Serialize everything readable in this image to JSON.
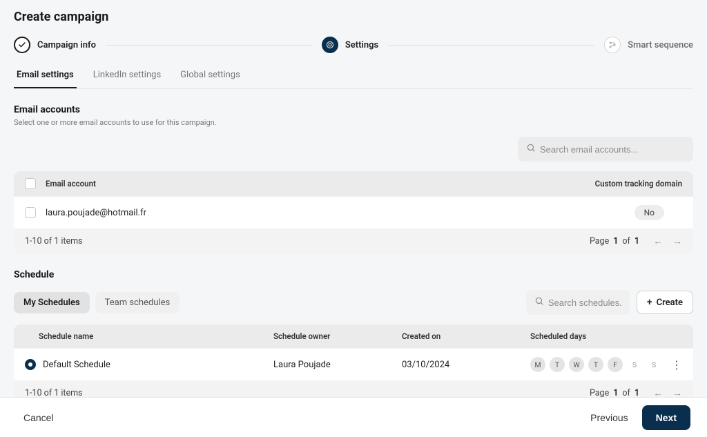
{
  "page_title": "Create campaign",
  "stepper": {
    "step1": "Campaign info",
    "step2": "Settings",
    "step3": "Smart sequence"
  },
  "tabs": {
    "email": "Email settings",
    "linkedin": "LinkedIn settings",
    "global": "Global settings"
  },
  "email_accounts": {
    "title": "Email accounts",
    "subtitle": "Select one or more email accounts to use for this campaign.",
    "search_placeholder": "Search email accounts...",
    "header_account": "Email account",
    "header_domain": "Custom tracking domain",
    "rows": [
      {
        "email": "laura.poujade@hotmail.fr",
        "domain_badge": "No"
      }
    ],
    "footer_count": "1-10 of 1 items",
    "page_label": "Page",
    "page_current": "1",
    "page_of": "of",
    "page_total": "1"
  },
  "schedule": {
    "title": "Schedule",
    "seg_my": "My Schedules",
    "seg_team": "Team schedules",
    "search_placeholder": "Search schedules...",
    "create_label": "Create",
    "header_name": "Schedule name",
    "header_owner": "Schedule owner",
    "header_created": "Created on",
    "header_days": "Scheduled days",
    "rows": [
      {
        "name": "Default Schedule",
        "owner": "Laura Poujade",
        "created": "03/10/2024",
        "days": [
          "M",
          "T",
          "W",
          "T",
          "F",
          "S",
          "S"
        ]
      }
    ],
    "footer_count": "1-10 of 1 items",
    "page_label": "Page",
    "page_current": "1",
    "page_of": "of",
    "page_total": "1"
  },
  "footer": {
    "cancel": "Cancel",
    "previous": "Previous",
    "next": "Next"
  }
}
